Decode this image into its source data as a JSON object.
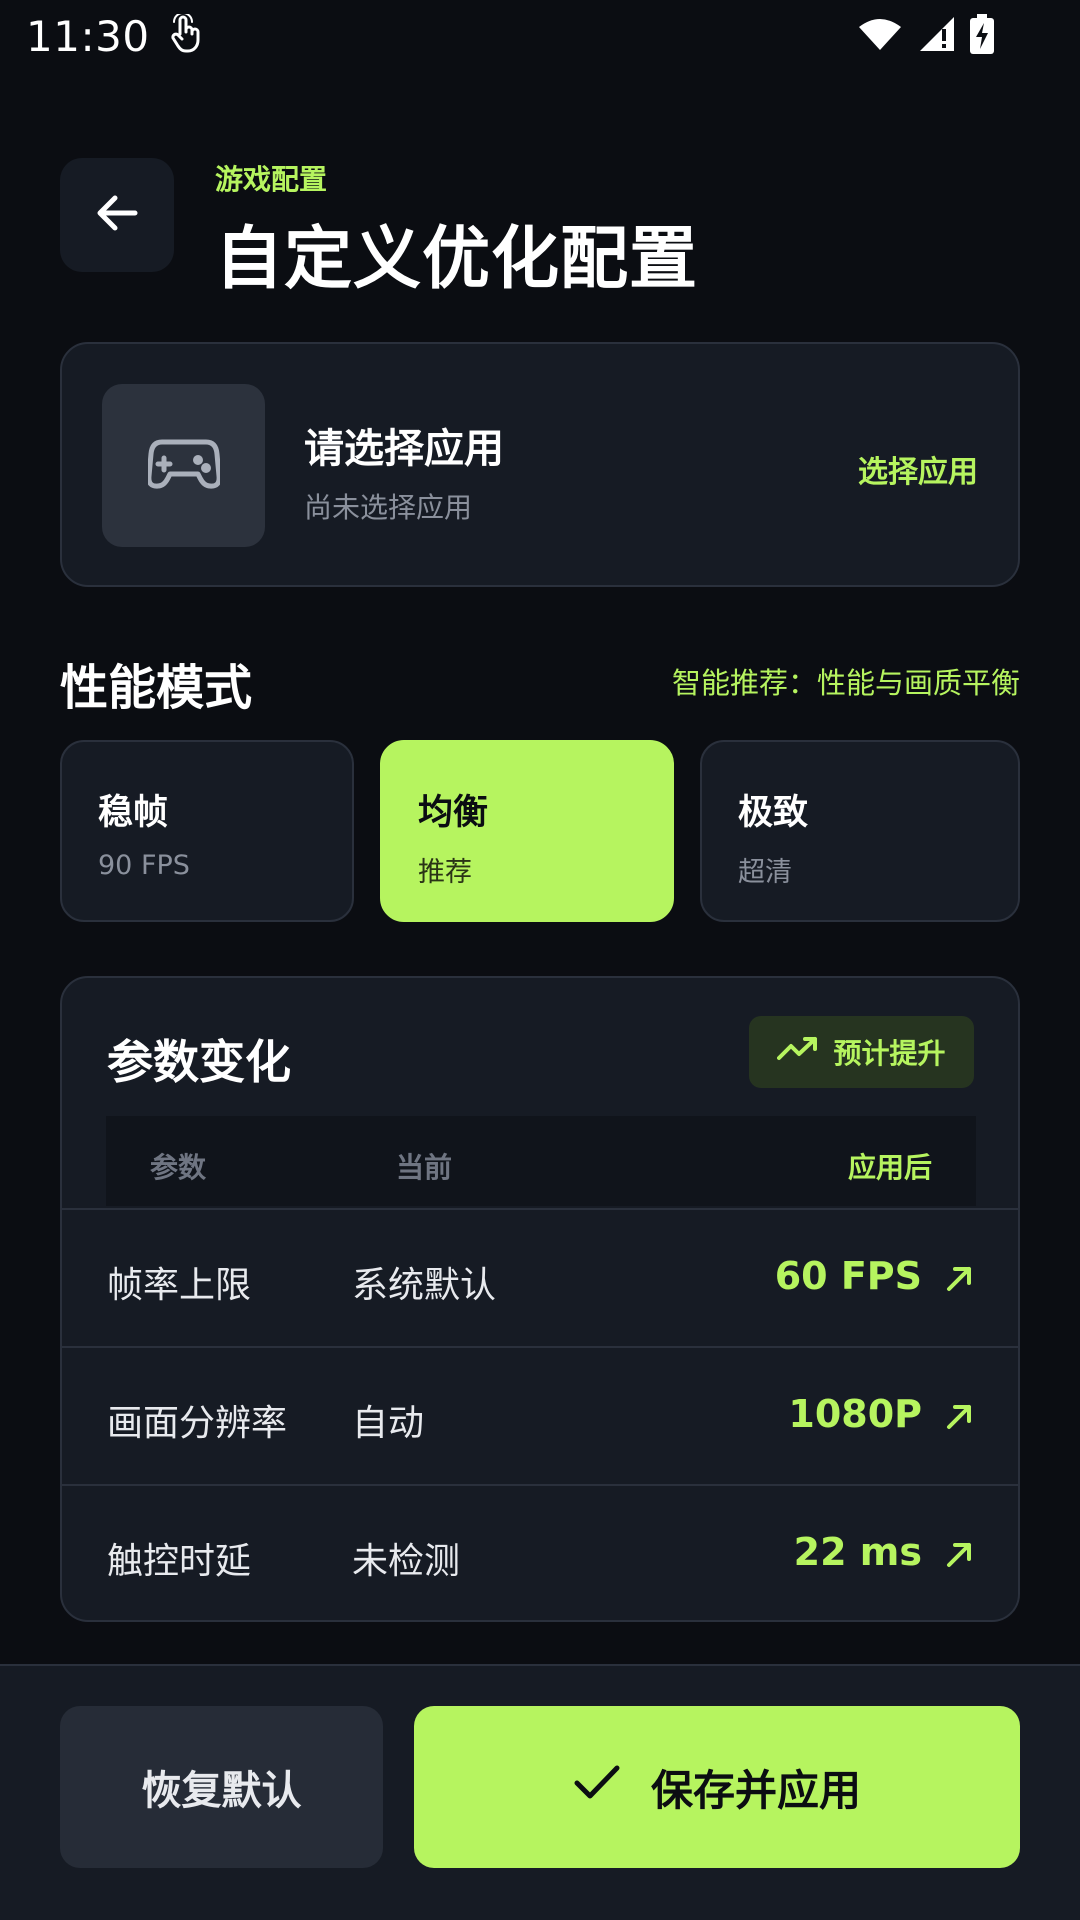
{
  "status_bar": {
    "time": "11:30",
    "icons": [
      "touch-icon",
      "wifi-icon",
      "signal-icon",
      "battery-charging-icon"
    ]
  },
  "header": {
    "breadcrumb": "游戏配置",
    "title": "自定义优化配置",
    "back_icon": "arrow-left-icon"
  },
  "app_card": {
    "title": "请选择应用",
    "subtitle": "尚未选择应用",
    "action": "选择应用",
    "icon": "gamepad-icon"
  },
  "performance": {
    "title": "性能模式",
    "hint": "智能推荐：性能与画质平衡",
    "modes": [
      {
        "name": "稳帧",
        "sub": "90 FPS",
        "selected": false
      },
      {
        "name": "均衡",
        "sub": "推荐",
        "selected": true
      },
      {
        "name": "极致",
        "sub": "超清",
        "selected": false
      }
    ]
  },
  "params": {
    "title": "参数变化",
    "badge": "预计提升",
    "headers": {
      "param": "参数",
      "current": "当前",
      "after": "应用后"
    },
    "rows": [
      {
        "name": "帧率上限",
        "current": "系统默认",
        "after": "60 FPS"
      },
      {
        "name": "画面分辨率",
        "current": "自动",
        "after": "1080P"
      },
      {
        "name": "触控时延",
        "current": "未检测",
        "after": "22 ms"
      }
    ]
  },
  "actions": {
    "reset": "恢复默认",
    "save": "保存并应用"
  },
  "colors": {
    "accent": "#b6f45f",
    "background": "#0b0d12",
    "card": "#161b24"
  }
}
